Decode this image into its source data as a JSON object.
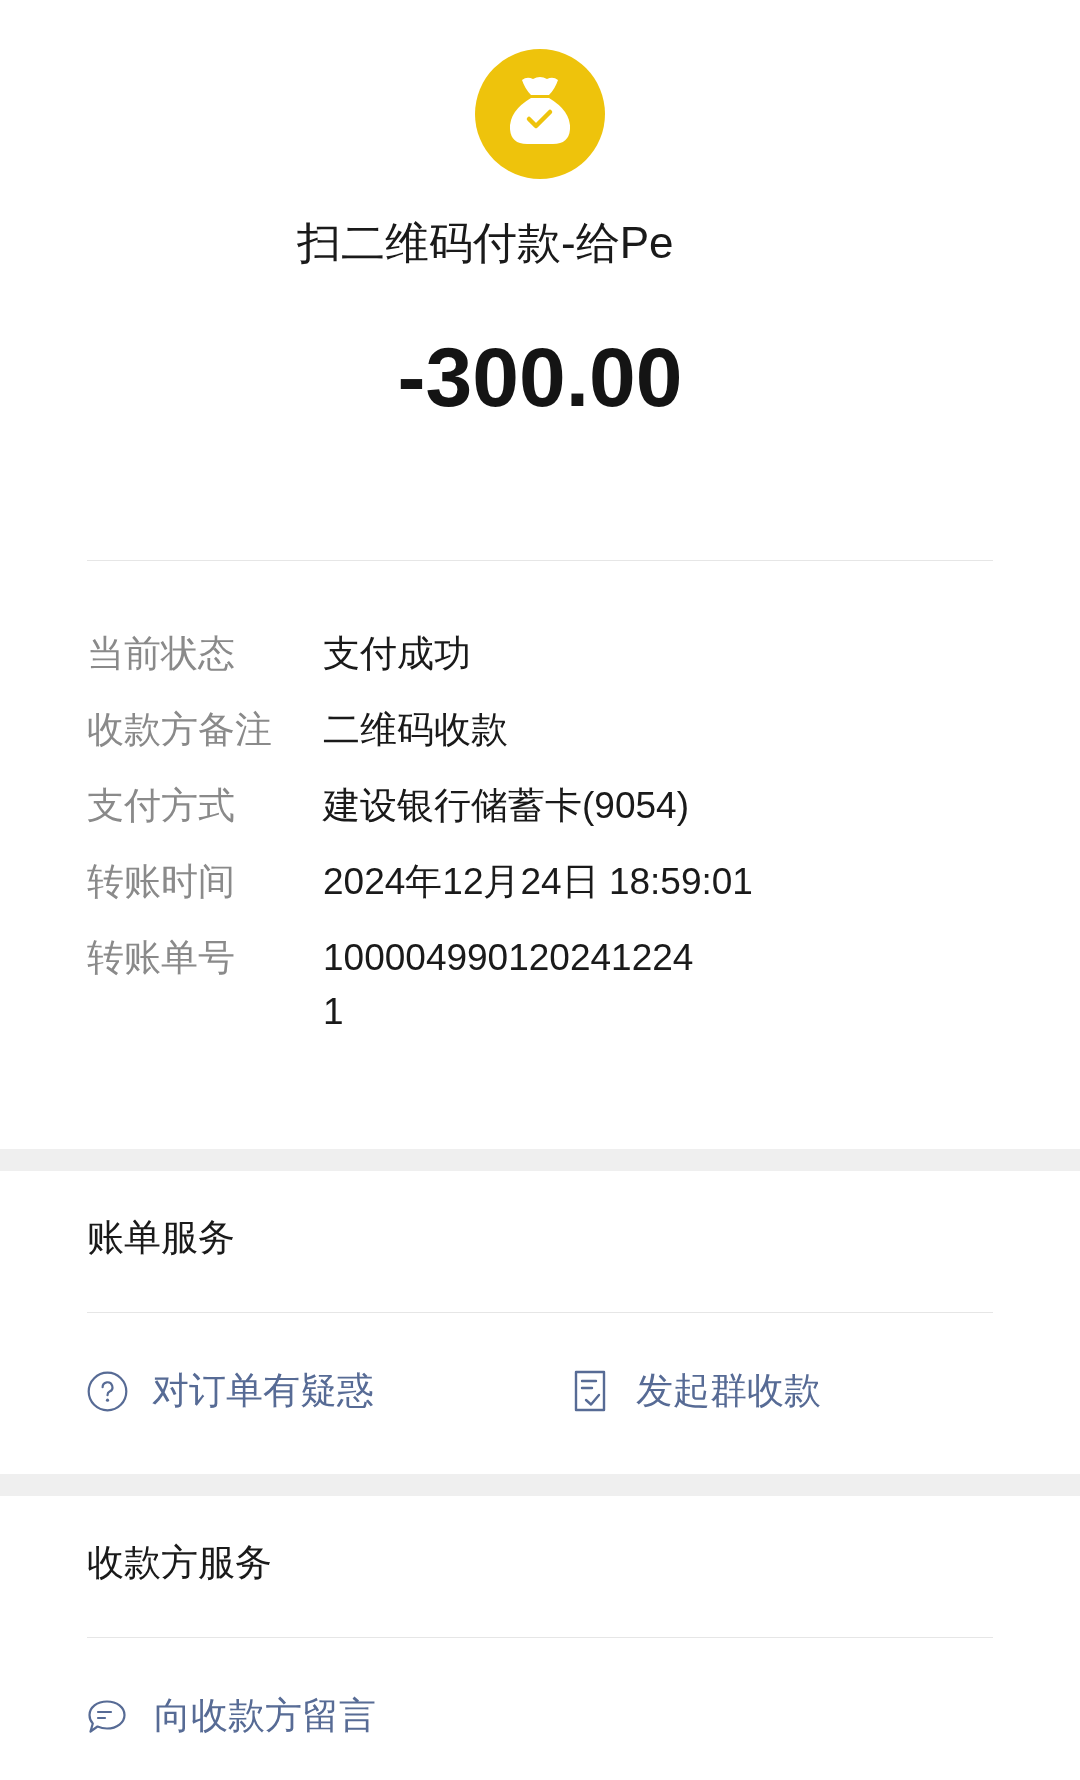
{
  "header": {
    "title": "扫二维码付款-给Pe",
    "amount": "-300.00"
  },
  "details": [
    {
      "label": "当前状态",
      "lines": [
        "支付成功"
      ]
    },
    {
      "label": "收款方备注",
      "lines": [
        "二维码收款"
      ]
    },
    {
      "label": "支付方式",
      "lines": [
        "建设银行储蓄卡(9054)"
      ]
    },
    {
      "label": "转账时间",
      "lines": [
        "2024年12月24日 18:59:01"
      ]
    },
    {
      "label": "转账单号",
      "lines": [
        "100004990120241224",
        "1"
      ]
    }
  ],
  "sections": [
    {
      "title": "账单服务",
      "actions": [
        {
          "kind": "question",
          "label": "对订单有疑惑"
        },
        {
          "kind": "receipt",
          "label": "发起群收款"
        }
      ]
    },
    {
      "title": "收款方服务",
      "actions": [
        {
          "kind": "message",
          "label": "向收款方留言"
        }
      ]
    }
  ]
}
